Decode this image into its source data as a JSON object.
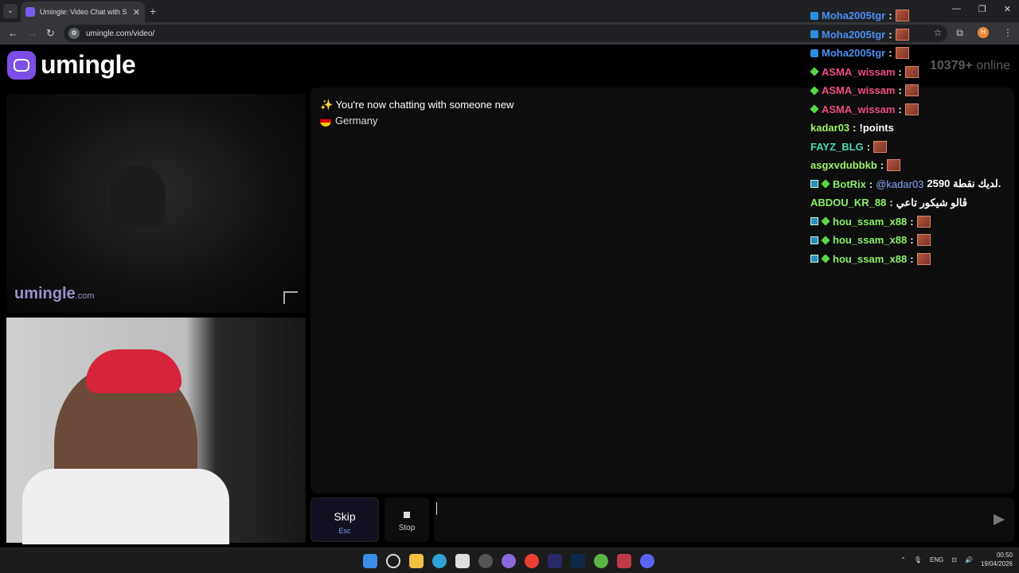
{
  "browser": {
    "tab_title": "Umingle: Video Chat with S",
    "url": "umingle.com/video/",
    "profile_initial": "H"
  },
  "site": {
    "logo": "umingle",
    "online_count": "10379+",
    "online_label": "online",
    "watermark": "umingle",
    "watermark_tld": ".com"
  },
  "chat": {
    "system_message": "You're now chatting with someone new",
    "country": "Germany"
  },
  "controls": {
    "skip_label": "Skip",
    "skip_key": "Esc",
    "stop_label": "Stop",
    "message_placeholder": ""
  },
  "stream_chat": [
    {
      "user": "Moha2005tgr",
      "badge": "blue",
      "color": "blue",
      "text": "",
      "emote": true
    },
    {
      "user": "Moha2005tgr",
      "badge": "blue",
      "color": "blue",
      "text": "",
      "emote": true
    },
    {
      "user": "Moha2005tgr",
      "badge": "blue",
      "color": "blue",
      "text": "",
      "emote": true
    },
    {
      "user": "ASMA_wissam",
      "badge": "green",
      "color": "pink",
      "text": "",
      "emote": true
    },
    {
      "user": "ASMA_wissam",
      "badge": "green",
      "color": "pink",
      "text": "",
      "emote": true
    },
    {
      "user": "ASMA_wissam",
      "badge": "green",
      "color": "pink",
      "text": "",
      "emote": true
    },
    {
      "user": "kadar03",
      "badge": "",
      "color": "lime",
      "text": "!points",
      "emote": false
    },
    {
      "user": "FAYZ_BLG",
      "badge": "",
      "color": "teal",
      "text": "",
      "emote": true
    },
    {
      "user": "asgxvdubbkb",
      "badge": "",
      "color": "lime",
      "text": "",
      "emote": true
    },
    {
      "user": "BotRix",
      "badge": "mod",
      "color": "green",
      "text": "2590 لديك نقطة.",
      "mention": "@kadar03",
      "emote": false
    },
    {
      "user": "ABDOU_KR_88",
      "badge": "",
      "color": "green",
      "text": "ڨالو شيكور تاعي",
      "emote": false
    },
    {
      "user": "hou_ssam_x88",
      "badge": "mod-green",
      "color": "green",
      "text": "",
      "emote": true
    },
    {
      "user": "hou_ssam_x88",
      "badge": "mod-green",
      "color": "green",
      "text": "",
      "emote": true
    },
    {
      "user": "hou_ssam_x88",
      "badge": "mod-green",
      "color": "green",
      "text": "",
      "emote": true
    }
  ],
  "taskbar": {
    "language": "ENG",
    "time": "00:50",
    "date": "19/04/2026"
  }
}
